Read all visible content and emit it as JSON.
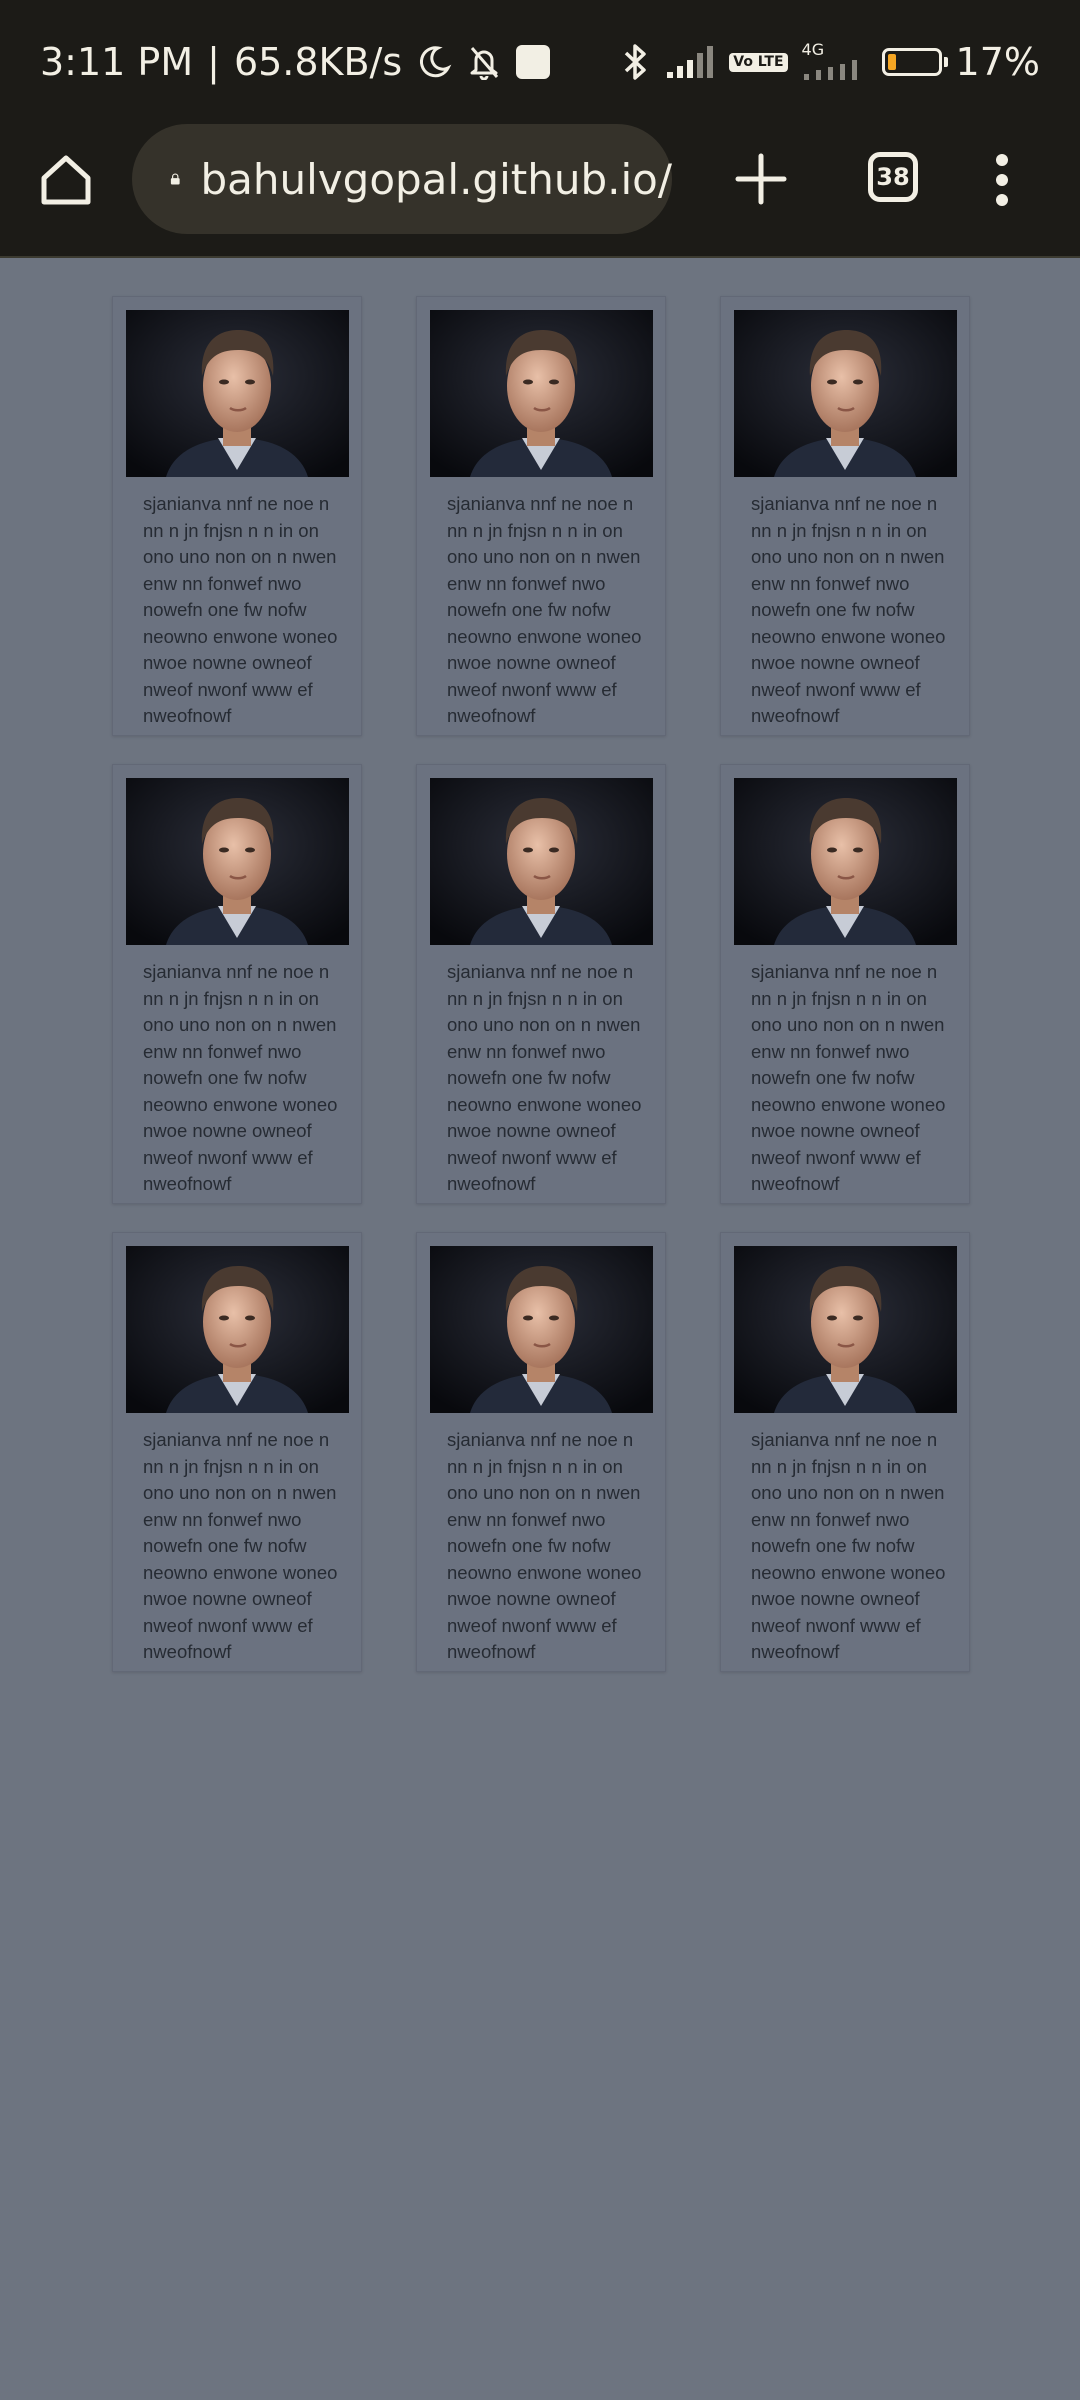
{
  "status_bar": {
    "time": "3:11 PM",
    "separator": "|",
    "speed": "65.8KB/s",
    "volte": "Vo LTE",
    "network": "4G",
    "battery_percent": "17%",
    "battery_level": 0.17,
    "battery_color": "#f5a623"
  },
  "toolbar": {
    "url": "bahulvgopal.github.io/",
    "tab_count": "38",
    "home_icon": "home-icon",
    "lock_icon": "lock-icon",
    "new_tab_icon": "plus-icon",
    "menu_icon": "kebab-menu-icon"
  },
  "cards": [
    {
      "text": "sjanianva nnf ne noe n nn n jn fnjsn n n in on ono uno non on n nwen enw nn fonwef nwo nowefn one fw nofw neowno enwone woneo nwoe nowne owneof nweof nwonf www ef nweofnowf"
    },
    {
      "text": "sjanianva nnf ne noe n nn n jn fnjsn n n in on ono uno non on n nwen enw nn fonwef nwo nowefn one fw nofw neowno enwone woneo nwoe nowne owneof nweof nwonf www ef nweofnowf"
    },
    {
      "text": "sjanianva nnf ne noe n nn n jn fnjsn n n in on ono uno non on n nwen enw nn fonwef nwo nowefn one fw nofw neowno enwone woneo nwoe nowne owneof nweof nwonf www ef nweofnowf"
    },
    {
      "text": "sjanianva nnf ne noe n nn n jn fnjsn n n in on ono uno non on n nwen enw nn fonwef nwo nowefn one fw nofw neowno enwone woneo nwoe nowne owneof nweof nwonf www ef nweofnowf"
    },
    {
      "text": "sjanianva nnf ne noe n nn n jn fnjsn n n in on ono uno non on n nwen enw nn fonwef nwo nowefn one fw nofw neowno enwone woneo nwoe nowne owneof nweof nwonf www ef nweofnowf"
    },
    {
      "text": "sjanianva nnf ne noe n nn n jn fnjsn n n in on ono uno non on n nwen enw nn fonwef nwo nowefn one fw nofw neowno enwone woneo nwoe nowne owneof nweof nwonf www ef nweofnowf"
    },
    {
      "text": "sjanianva nnf ne noe n nn n jn fnjsn n n in on ono uno non on n nwen enw nn fonwef nwo nowefn one fw nofw neowno enwone woneo nwoe nowne owneof nweof nwonf www ef nweofnowf"
    },
    {
      "text": "sjanianva nnf ne noe n nn n jn fnjsn n n in on ono uno non on n nwen enw nn fonwef nwo nowefn one fw nofw neowno enwone woneo nwoe nowne owneof nweof nwonf www ef nweofnowf"
    },
    {
      "text": "sjanianva nnf ne noe n nn n jn fnjsn n n in on ono uno non on n nwen enw nn fonwef nwo nowefn one fw nofw neowno enwone woneo nwoe nowne owneof nweof nwonf www ef nweofnowf"
    }
  ],
  "colors": {
    "page_background": "#6d7480",
    "browser_chrome": "#1c1b17",
    "url_pill": "#35322a",
    "card_text": "#262b33"
  }
}
